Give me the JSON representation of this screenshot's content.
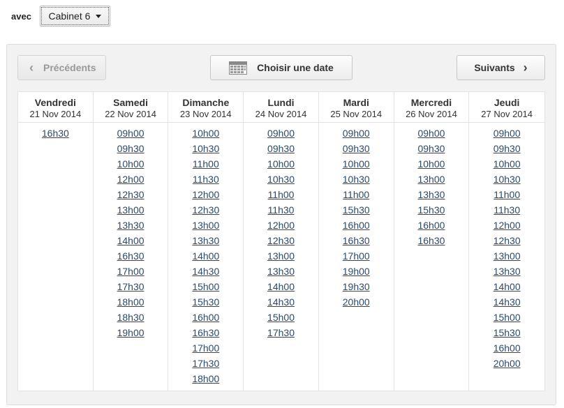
{
  "filter": {
    "label": "avec",
    "selected": "Cabinet 6"
  },
  "nav": {
    "prev_label": "Précédents",
    "choose_label": "Choisir une date",
    "next_label": "Suivants"
  },
  "days": [
    {
      "name": "Vendredi",
      "date": "21 Nov 2014",
      "slots": [
        "16h30"
      ]
    },
    {
      "name": "Samedi",
      "date": "22 Nov 2014",
      "slots": [
        "09h00",
        "09h30",
        "10h00",
        "12h00",
        "12h30",
        "13h00",
        "13h30",
        "14h00",
        "16h30",
        "17h00",
        "17h30",
        "18h00",
        "18h30",
        "19h00"
      ]
    },
    {
      "name": "Dimanche",
      "date": "23 Nov 2014",
      "slots": [
        "10h00",
        "10h30",
        "11h00",
        "11h30",
        "12h00",
        "12h30",
        "13h00",
        "13h30",
        "14h00",
        "14h30",
        "15h00",
        "15h30",
        "16h00",
        "16h30",
        "17h00",
        "17h30",
        "18h00"
      ]
    },
    {
      "name": "Lundi",
      "date": "24 Nov 2014",
      "slots": [
        "09h00",
        "09h30",
        "10h00",
        "10h30",
        "11h00",
        "11h30",
        "12h00",
        "12h30",
        "13h00",
        "13h30",
        "14h00",
        "14h30",
        "15h00",
        "17h30"
      ]
    },
    {
      "name": "Mardi",
      "date": "25 Nov 2014",
      "slots": [
        "09h00",
        "09h30",
        "10h00",
        "10h30",
        "11h00",
        "15h30",
        "16h00",
        "16h30",
        "17h00",
        "19h00",
        "19h30",
        "20h00"
      ]
    },
    {
      "name": "Mercredi",
      "date": "26 Nov 2014",
      "slots": [
        "09h00",
        "09h30",
        "10h00",
        "13h00",
        "13h30",
        "15h30",
        "16h00",
        "16h30"
      ]
    },
    {
      "name": "Jeudi",
      "date": "27 Nov 2014",
      "slots": [
        "09h00",
        "09h30",
        "10h00",
        "10h30",
        "11h00",
        "11h30",
        "12h00",
        "12h30",
        "13h00",
        "13h30",
        "14h00",
        "14h30",
        "15h00",
        "15h30",
        "16h00",
        "20h00"
      ]
    }
  ]
}
